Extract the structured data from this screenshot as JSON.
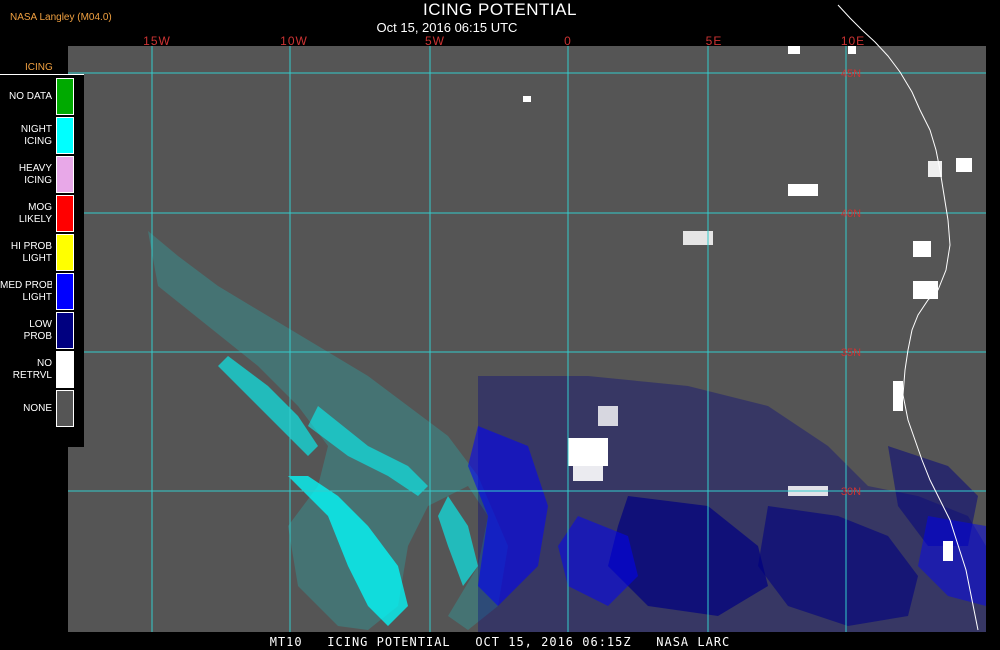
{
  "header": {
    "agency": "NASA Langley (M04.0)",
    "title": "ICING POTENTIAL",
    "subtitle": "Oct 15, 2016 06:15 UTC"
  },
  "map": {
    "longitude_labels": [
      "15W",
      "10W",
      "5W",
      "0",
      "5E",
      "10E"
    ],
    "latitude_labels": [
      "45N",
      "40N",
      "35N",
      "30N"
    ],
    "colors": {
      "background": "#555555",
      "gridlines": "#33cccc",
      "coastline": "#ffffff",
      "lat_label": "#cc3333"
    }
  },
  "legend": {
    "title": "ICING",
    "items": [
      {
        "label": "NO DATA",
        "color": "#00aa00"
      },
      {
        "label": "NIGHT\nICING",
        "color": "#00ffff"
      },
      {
        "label": "HEAVY\nICING",
        "color": "#e8a8e8"
      },
      {
        "label": "MOG\nLIKELY",
        "color": "#ff0000"
      },
      {
        "label": "HI PROB\nLIGHT",
        "color": "#ffff00"
      },
      {
        "label": "MED PROB\nLIGHT",
        "color": "#0000ff"
      },
      {
        "label": "LOW\nPROB",
        "color": "#000080"
      },
      {
        "label": "NO\nRETRVL",
        "color": "#ffffff"
      },
      {
        "label": "NONE",
        "color": "#555555"
      }
    ]
  },
  "footer": {
    "caption": "MT10   ICING POTENTIAL   OCT 15, 2016 06:15Z   NASA LARC"
  }
}
